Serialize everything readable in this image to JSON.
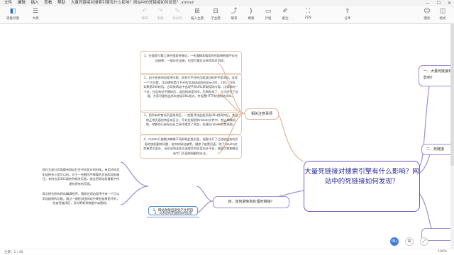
{
  "menubar": {
    "items": [
      "文件",
      "编辑",
      "插入",
      "查看",
      "帮助"
    ],
    "title": "大量死链接对搜索引擎有什么影响？网站中的死链接如何发现？.xmind"
  },
  "toolbar": {
    "left": [
      {
        "label": "思维导图",
        "icon": "mindmap-icon"
      },
      {
        "label": "大纲",
        "icon": "outline-icon"
      }
    ],
    "middle": [
      {
        "label": "撤销",
        "icon": "undo-icon"
      },
      {
        "label": "重做",
        "icon": "redo-icon"
      },
      {
        "label": "格式刷",
        "icon": "format-brush-icon"
      },
      {
        "label": "插入主题",
        "icon": "insert-topic-icon"
      },
      {
        "label": "子主题",
        "icon": "subtopic-icon"
      },
      {
        "label": "联系",
        "icon": "relation-icon"
      },
      {
        "label": "概要",
        "icon": "summary-icon"
      },
      {
        "label": "外框",
        "icon": "boundary-icon"
      },
      {
        "label": "备注",
        "icon": "note-icon"
      }
    ],
    "zen": {
      "label": "ZEN",
      "icon": "zen-icon"
    },
    "share": {
      "label": "分享",
      "icon": "share-icon"
    },
    "right": [
      {
        "label": "图标",
        "icon": "palette-icon"
      },
      {
        "label": "格式",
        "icon": "format-icon"
      }
    ]
  },
  "mindmap": {
    "central": "大量死链接对搜索引擎有什么影响？网站中的死链接如何发现？",
    "branch_attention": "相关注意事项",
    "branch_four": "四、如何避免和处理死链接？",
    "branch_one": "一、大量死链接有什么影响？",
    "branch_two": "二、死链接",
    "notes": [
      "1、在搜索引擎工具中搜索关键词，一些要精准搜索的死链接数据不存在连接数，一般存在连接，也是尽量及去除得及时消除。",
      "2、由于很多网站程序问题，很多打不开的页面返回码并不是404，这是一个大问题，比如明明是打不开的页面却返回码显示301、200、500，如果是200的话，会导致网站中出现不同URL获取相同内容。比如我的一个站，社区的帖子删除后，返回码却是500，后期发现了，立马进行了处理。大家尽量找出所有错误URL格式，并设置HTTP状态码为404。",
      "3、把所有的错误页面找到后，一定要寻找此类页面URL相同特征，并且和正常页面的特征有区分，写对应规则到robots文件中，禁止蜘蛛抓取，就算你已经在站长工具中提交了死链，也建议robots封禁抓取。",
      "4、robots只能解决蜘蛛不再抓取此类页面，但解决不了已经放出来的页面的快照删除问题，若你的网站被黑，删除了被黑页面，除了robots封禁被黑页面外，还应该将这些页面提交到百度站长平台，搜索引擎蜘蛛会有专门页面快照删除办法。"
    ],
    "left_note_top": "现在大部分页面都有网站打开代码显示的时候，有用代码优化链接多少是可以的。对于一些删除不需要的页面和导航路径，有时应用301跳转到相关页面，就会把网站权重集中传递给原有的页面。",
    "left_note_bottom": "再次研究所有网站编辑程序，通常在网站程序中有一个可以添加链接的功能，通过一键检测出网站中哪些链接是坏的，检查死链接后，及时更新到数据中或删除。",
    "sub1": "1、网站改版后避免产生死链",
    "sub2": "2、对发现的死链接如何处理"
  },
  "statusbar": {
    "left": "主题：1 / 40",
    "zoom": "100%"
  },
  "float_buttons": [
    "du-icon",
    "layout-icon",
    "fit-icon"
  ]
}
